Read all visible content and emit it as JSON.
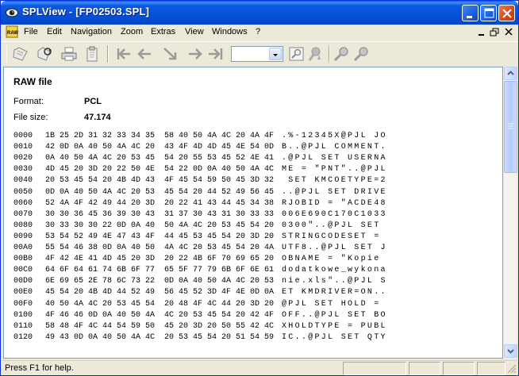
{
  "window": {
    "title": "SPLView - [FP02503.SPL]",
    "accent": "#0a5fe8"
  },
  "menu": {
    "items": [
      "File",
      "Edit",
      "Navigation",
      "Zoom",
      "Extras",
      "View",
      "Windows",
      "?"
    ]
  },
  "toolbar": {
    "icons": [
      "open-icon",
      "reload-icon",
      "print-icon",
      "clipboard-icon",
      "first-page-icon",
      "prev-page-icon",
      "jump-icon",
      "next-page-icon",
      "last-page-icon",
      "zoom-select",
      "zoom-fit-icon",
      "zoom-icon",
      "search-icon",
      "search-next-icon"
    ],
    "zoom_value": ""
  },
  "document": {
    "heading": "RAW file",
    "format_label": "Format:",
    "format_value": "PCL",
    "size_label": "File size:",
    "size_value": "47.174",
    "rows": [
      {
        "offset": "0000",
        "bytes": "1B 25 2D 31 32 33 34 35  58 40 50 4A 4C 20 4A 4F",
        "ascii": ".%-12345X@PJL JO"
      },
      {
        "offset": "0010",
        "bytes": "42 0D 0A 40 50 4A 4C 20  43 4F 4D 4D 45 4E 54 0D",
        "ascii": "B..@PJL COMMENT."
      },
      {
        "offset": "0020",
        "bytes": "0A 40 50 4A 4C 20 53 45  54 20 55 53 45 52 4E 41",
        "ascii": ".@PJL SET USERNA"
      },
      {
        "offset": "0030",
        "bytes": "4D 45 20 3D 20 22 50 4E  54 22 0D 0A 40 50 4A 4C",
        "ascii": "ME = \"PNT\"..@PJL"
      },
      {
        "offset": "0040",
        "bytes": "20 53 45 54 20 4B 4D 43  4F 45 54 59 50 45 3D 32",
        "ascii": " SET KMCOETYPE=2"
      },
      {
        "offset": "0050",
        "bytes": "0D 0A 40 50 4A 4C 20 53  45 54 20 44 52 49 56 45",
        "ascii": "..@PJL SET DRIVE"
      },
      {
        "offset": "0060",
        "bytes": "52 4A 4F 42 49 44 20 3D  20 22 41 43 44 45 34 38",
        "ascii": "RJOBID = \"ACDE48"
      },
      {
        "offset": "0070",
        "bytes": "30 30 36 45 36 39 30 43  31 37 30 43 31 30 33 33",
        "ascii": "006E690C170C1033"
      },
      {
        "offset": "0080",
        "bytes": "30 33 30 30 22 0D 0A 40  50 4A 4C 20 53 45 54 20",
        "ascii": "0300\"..@PJL SET "
      },
      {
        "offset": "0090",
        "bytes": "53 54 52 49 4E 47 43 4F  44 45 53 45 54 20 3D 20",
        "ascii": "STRINGCODESET = "
      },
      {
        "offset": "00A0",
        "bytes": "55 54 46 38 0D 0A 40 50  4A 4C 20 53 45 54 20 4A",
        "ascii": "UTF8..@PJL SET J"
      },
      {
        "offset": "00B0",
        "bytes": "4F 42 4E 41 4D 45 20 3D  20 22 4B 6F 70 69 65 20",
        "ascii": "OBNAME = \"Kopie "
      },
      {
        "offset": "00C0",
        "bytes": "64 6F 64 61 74 6B 6F 77  65 5F 77 79 6B 6F 6E 61",
        "ascii": "dodatkowe_wykona"
      },
      {
        "offset": "00D0",
        "bytes": "6E 69 65 2E 78 6C 73 22  0D 0A 40 50 4A 4C 20 53",
        "ascii": "nie.xls\"..@PJL S"
      },
      {
        "offset": "00E0",
        "bytes": "45 54 20 4B 4D 44 52 49  56 45 52 3D 4F 4E 0D 0A",
        "ascii": "ET KMDRIVER=ON.."
      },
      {
        "offset": "00F0",
        "bytes": "40 50 4A 4C 20 53 45 54  20 48 4F 4C 44 20 3D 20",
        "ascii": "@PJL SET HOLD = "
      },
      {
        "offset": "0100",
        "bytes": "4F 46 46 0D 0A 40 50 4A  4C 20 53 45 54 20 42 4F",
        "ascii": "OFF..@PJL SET BO"
      },
      {
        "offset": "0110",
        "bytes": "58 48 4F 4C 44 54 59 50  45 20 3D 20 50 55 42 4C",
        "ascii": "XHOLDTYPE = PUBL"
      },
      {
        "offset": "0120",
        "bytes": "49 43 0D 0A 40 50 4A 4C  20 53 45 54 20 51 54 59",
        "ascii": "IC..@PJL SET QTY"
      }
    ]
  },
  "status": {
    "text": "Press F1 for help."
  }
}
